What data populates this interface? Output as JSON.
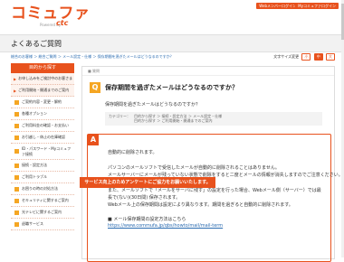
{
  "header": {
    "logo": "コミュファ",
    "powered_by": "Powered by",
    "ctc": "ctc",
    "btn1": "Webメンバーログイン",
    "btn2": "Myコミュファログイン"
  },
  "page_title": "よくあるご質問",
  "breadcrumb": "総合のお客様 ＞ 総合ご質問 ＞ メール設定・仕様 ＞ 保存期間を過ぎたメールはどうなるのですか？",
  "font_size": {
    "label": "文字サイズ変更",
    "small": "小",
    "medium": "中",
    "large": "大"
  },
  "sidebar": {
    "heading": "目的から探す",
    "items": [
      {
        "label": "お申し込みをご検討中のお客さま",
        "color": "#f08a5d",
        "sub": true
      },
      {
        "label": "ご利用開始・開通までのご案内",
        "color": "#f08a5d",
        "sub": true
      },
      {
        "label": "ご契約内容・変更・解約",
        "color": "#f5a623",
        "sub": false
      },
      {
        "label": "各種オプション",
        "color": "#f5a623",
        "sub": false
      },
      {
        "label": "ご利用料金の確認・お支払い",
        "color": "#f5a623",
        "sub": false
      },
      {
        "label": "お引越し・休止の在庫確認",
        "color": "#f5a623",
        "sub": false
      },
      {
        "label": "ID・パスワード・Myコミュファ接続",
        "color": "#f5a623",
        "sub": false,
        "tall": true
      },
      {
        "label": "接続・設定方法",
        "color": "#f5a623",
        "sub": false
      },
      {
        "label": "ご利用トラブル",
        "color": "#f5a623",
        "sub": false
      },
      {
        "label": "お困りの時の対処方法",
        "color": "#f5a623",
        "sub": false
      },
      {
        "label": "セキュリティに関するご案内",
        "color": "#f5a623",
        "sub": false
      },
      {
        "label": "光テレビに関するご案内",
        "color": "#f5a623",
        "sub": false
      },
      {
        "label": "退職サービス",
        "color": "#f5a623",
        "sub": false
      }
    ]
  },
  "main": {
    "top_label": "■ 質問",
    "q_badge": "Q",
    "question_title": "保存期間を過ぎたメールはどうなるのですか？",
    "question_text": "保存期間を過ぎたメールはどうなるのですか？",
    "category_line1": "カテゴリー：　目的から探す ＞ 接続・設定方法 ＞ メール設定・仕様",
    "category_line2": "　　　　　　　目的から探す ＞ ご利用開始・開通までのご案内",
    "a_badge": "A",
    "answer_lines": [
      "自動的に削除されます。",
      "パソコンのメールソフトで受信したメールが自動的に削除されることはありません。",
      "メールサーバーにメールが残っていない状態で削除をすると二度とメールの情報が消失しますのでご注意ください。",
      "また、メールソフトで「メールをサーバに残す」の設定を行った場合、Webメール側（サーバー）では最",
      "長で(ない)(30日間) 保存されます。",
      "Webメール上の保存期間は設定により異なります。期間を過ぎると自動的に削除されます。",
      "■ メール保存期間の設定方法はこちら"
    ],
    "answer_link": "https://www.commufa.jp/qbs/howto/mail/mail-term",
    "survey_button": "サービス向上のためアンケートにご協力をお願いいたします。"
  }
}
